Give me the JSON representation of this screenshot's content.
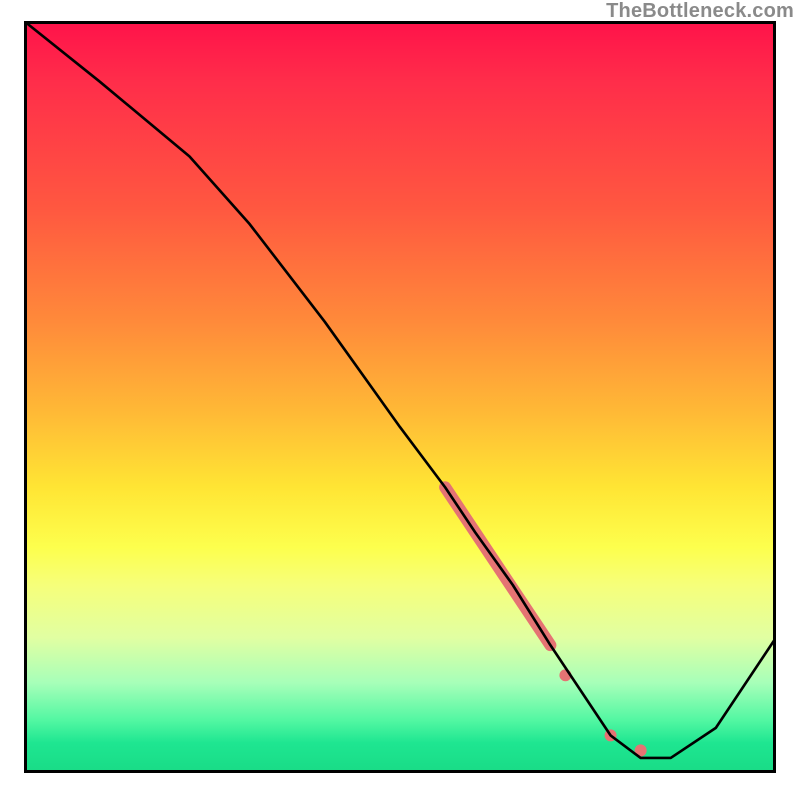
{
  "watermark": "TheBottleneck.com",
  "chart_data": {
    "type": "line",
    "title": "",
    "xlabel": "",
    "ylabel": "",
    "xlim": [
      0,
      100
    ],
    "ylim": [
      0,
      100
    ],
    "grid": false,
    "series": [
      {
        "name": "bottleneck-curve",
        "color": "#000000",
        "x": [
          0,
          10,
          22,
          30,
          40,
          50,
          56,
          60,
          65,
          70,
          74,
          78,
          82,
          86,
          92,
          100
        ],
        "y": [
          100,
          92,
          82,
          73,
          60,
          46,
          38,
          32,
          25,
          17,
          11,
          5,
          2,
          2,
          6,
          18
        ]
      }
    ],
    "highlight_segments": [
      {
        "name": "thick-band",
        "x": [
          56,
          70
        ],
        "y": [
          38,
          17
        ],
        "color": "#e57373",
        "width": 12
      },
      {
        "name": "dot-1",
        "cx": 72,
        "cy": 13,
        "r": 5,
        "color": "#e57373"
      },
      {
        "name": "dot-cluster-a",
        "cx": 78,
        "cy": 5,
        "r": 6,
        "color": "#e57373"
      },
      {
        "name": "dot-cluster-b",
        "cx": 82,
        "cy": 3,
        "r": 5,
        "color": "#e57373"
      }
    ],
    "colors": {
      "gradient_top": "#ff124a",
      "gradient_mid": "#ffe534",
      "gradient_bottom": "#19db86",
      "highlight": "#e57373",
      "line": "#000000",
      "watermark": "#8a8a8a"
    }
  }
}
